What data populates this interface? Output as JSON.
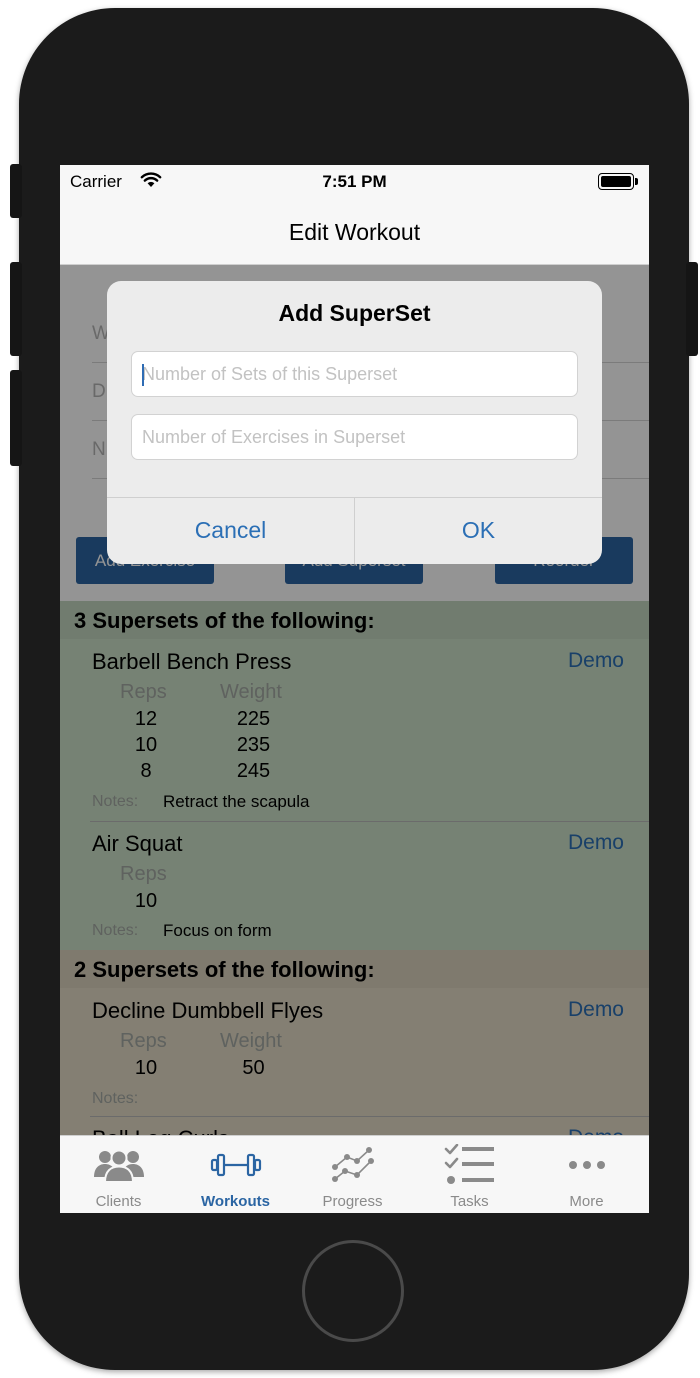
{
  "status_bar": {
    "carrier": "Carrier",
    "time": "7:51 PM"
  },
  "nav": {
    "title": "Edit Workout"
  },
  "background_form": {
    "fields": [
      "W",
      "D",
      "N"
    ],
    "buttons": [
      "Add Exercise",
      "Add Superset",
      "Reorder"
    ]
  },
  "supersets": [
    {
      "header": "3 Supersets of the following:",
      "exercises": [
        {
          "name": "Barbell Bench Press",
          "demo": "Demo",
          "reps_label": "Reps",
          "weight_label": "Weight",
          "rows": [
            {
              "reps": "12",
              "weight": "225"
            },
            {
              "reps": "10",
              "weight": "235"
            },
            {
              "reps": "8",
              "weight": "245"
            }
          ],
          "notes_label": "Notes:",
          "notes": "Retract the scapula"
        },
        {
          "name": "Air Squat",
          "demo": "Demo",
          "reps_label": "Reps",
          "rows": [
            {
              "reps": "10"
            }
          ],
          "notes_label": "Notes:",
          "notes": "Focus on form"
        }
      ]
    },
    {
      "header": "2 Supersets of the following:",
      "exercises": [
        {
          "name": "Decline Dumbbell Flyes",
          "demo": "Demo",
          "reps_label": "Reps",
          "weight_label": "Weight",
          "rows": [
            {
              "reps": "10",
              "weight": "50"
            }
          ],
          "notes_label": "Notes:",
          "notes": ""
        },
        {
          "name": "Ball Leg Curls",
          "demo": "Demo"
        }
      ]
    }
  ],
  "alert": {
    "title": "Add SuperSet",
    "sets_placeholder": "Number of Sets of this Superset",
    "exercises_placeholder": "Number of Exercises in Superset",
    "cancel": "Cancel",
    "ok": "OK"
  },
  "tab_bar": {
    "active": "Workouts",
    "tabs": [
      {
        "label": "Clients",
        "icon": "clients-icon"
      },
      {
        "label": "Workouts",
        "icon": "dumbbell-icon"
      },
      {
        "label": "Progress",
        "icon": "progress-chart-icon"
      },
      {
        "label": "Tasks",
        "icon": "tasks-checklist-icon"
      },
      {
        "label": "More",
        "icon": "more-dots-icon"
      }
    ]
  },
  "colors": {
    "accent": "#2b65a3",
    "link": "#2b6fb5",
    "superset_green": "#cce0c8",
    "superset_tan": "#e3dbc7"
  }
}
